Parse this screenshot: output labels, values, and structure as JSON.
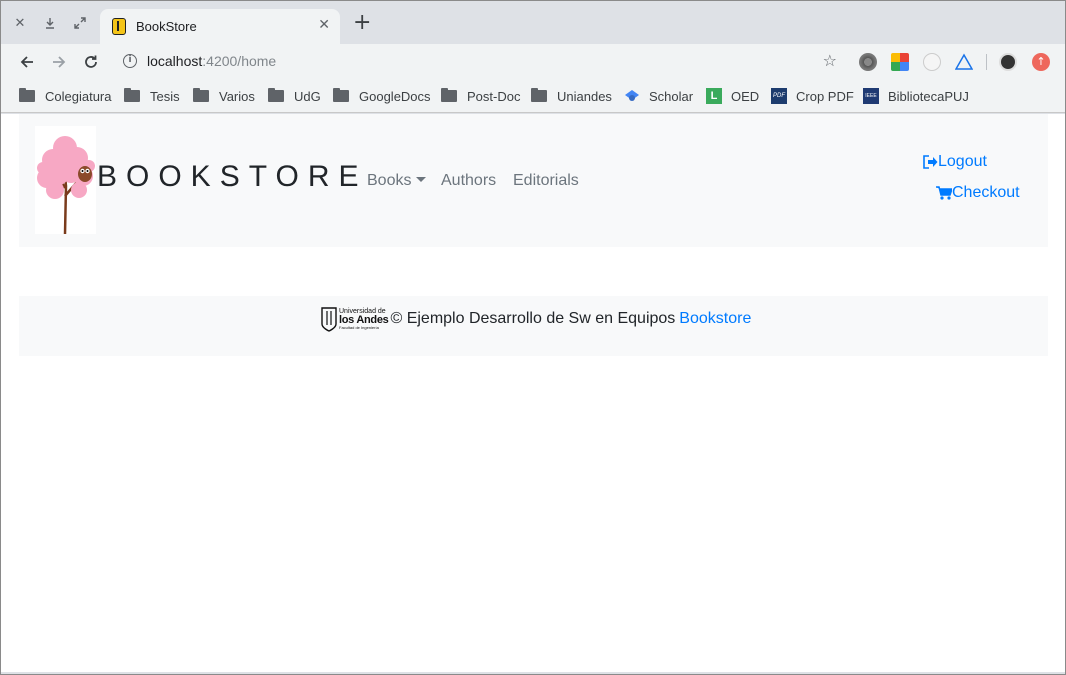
{
  "browser": {
    "tab_title": "BookStore",
    "url_host": "localhost",
    "url_path": ":4200/home",
    "bookmarks": [
      {
        "label": "Colegiatura",
        "icon": "folder-icon"
      },
      {
        "label": "Tesis",
        "icon": "folder-icon"
      },
      {
        "label": "Varios",
        "icon": "folder-icon"
      },
      {
        "label": "UdG",
        "icon": "folder-icon"
      },
      {
        "label": "GoogleDocs",
        "icon": "folder-icon"
      },
      {
        "label": "Post-Doc",
        "icon": "folder-icon"
      },
      {
        "label": "Uniandes",
        "icon": "folder-icon"
      },
      {
        "label": "Scholar",
        "icon": "scholar-icon"
      },
      {
        "label": "OED",
        "icon": "oed-icon"
      },
      {
        "label": "Crop PDF",
        "icon": "pdf-icon"
      },
      {
        "label": "BibliotecaPUJ",
        "icon": "ieee-icon"
      }
    ]
  },
  "navbar": {
    "brand": "BOOKSTORE",
    "books_label": "Books",
    "authors_label": "Authors",
    "editorials_label": "Editorials",
    "logout_label": "Logout",
    "checkout_label": "Checkout"
  },
  "footer": {
    "logo_line1": "Universidad de",
    "logo_line2": "los Andes",
    "logo_line3": "Facultad de Ingeniería",
    "text": "© Ejemplo Desarrollo de Sw en Equipos",
    "link": "Bookstore"
  },
  "colors": {
    "link": "#007bff",
    "navbar_bg": "#f8f9fa",
    "muted": "#6c757d"
  }
}
